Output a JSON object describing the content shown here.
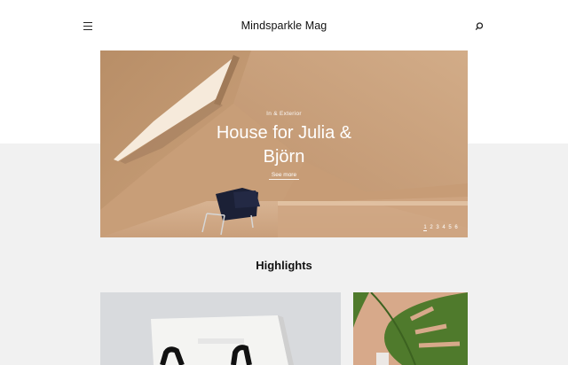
{
  "header": {
    "brand": "Mindsparkle Mag",
    "menu_icon": "hamburger-menu-icon",
    "search_icon": "search-icon"
  },
  "hero": {
    "category": "In & Exterior",
    "title": "House for Julia & Björn",
    "cta": "See more",
    "pages": [
      "1",
      "2",
      "3",
      "4",
      "5",
      "6"
    ],
    "active_page": "1"
  },
  "highlights": {
    "title": "Highlights"
  },
  "colors": {
    "page_bg": "#ffffff",
    "band_bg": "#f1f1f1",
    "wood": "#c89d76",
    "text": "#111111"
  }
}
